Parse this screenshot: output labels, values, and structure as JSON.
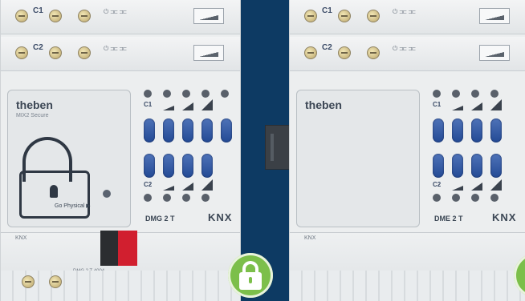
{
  "left_module": {
    "terminal_row_1": {
      "label": "C1"
    },
    "terminal_row_2": {
      "label": "C2"
    },
    "brand": "theben",
    "subbrand": "MIX2 Secure",
    "lock_action_label": "Go Physical ▶",
    "grid_label_c1": "C1",
    "grid_label_c2": "C2",
    "model": "DMG 2 T",
    "knx_logo": "KNX",
    "bottom_label": "KNX",
    "connector_note": "DMG 2 T 4004"
  },
  "right_module": {
    "terminal_row_1": {
      "label": "C1"
    },
    "terminal_row_2": {
      "label": "C2"
    },
    "brand": "theben",
    "grid_label_c1": "C1",
    "grid_label_c2": "C2",
    "model": "DME 2 T",
    "knx_logo": "KNX",
    "bottom_label": "KNX"
  },
  "icons": [
    "padlock-icon",
    "lock-badge-icon"
  ],
  "colors": {
    "background": "#0d3a63",
    "led_blue": "#2f57a6",
    "badge_green": "#7cbf4a",
    "connector_red": "#d11f2f"
  }
}
